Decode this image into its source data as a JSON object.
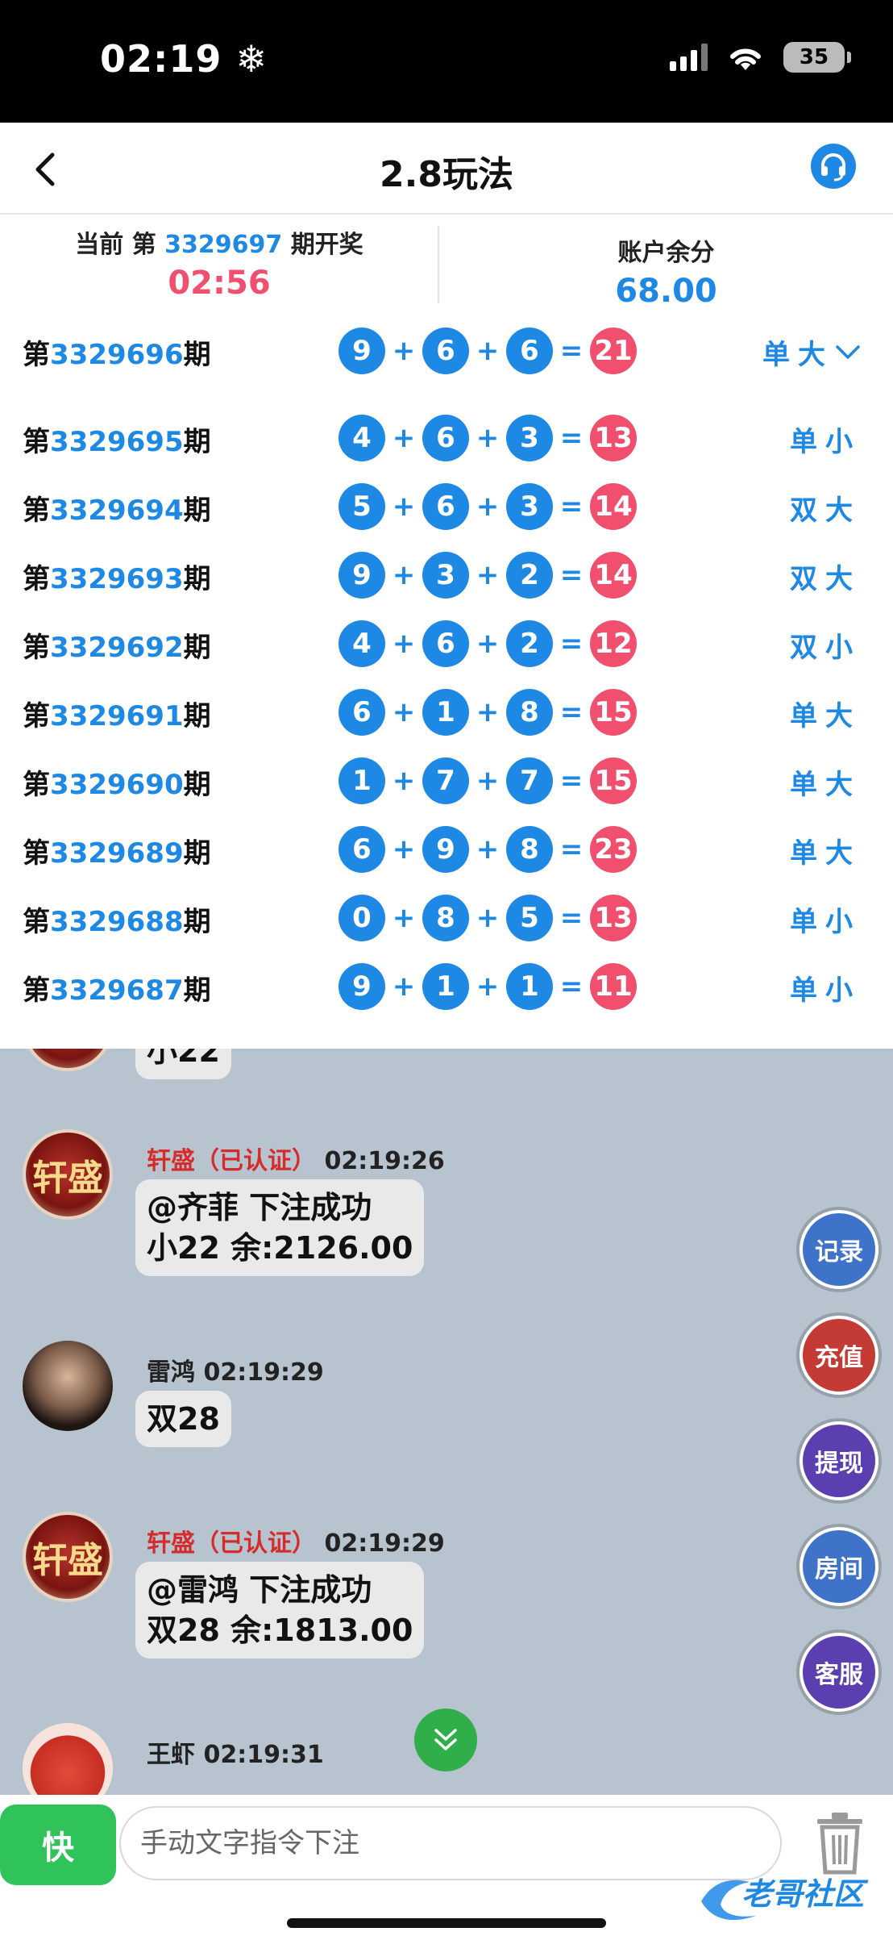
{
  "status": {
    "time": "02:19",
    "battery": "35"
  },
  "header": {
    "title": "2.8玩法"
  },
  "current": {
    "prefix": "当前 第",
    "period": "3329697",
    "suffix": "期开奖",
    "countdown": "02:56"
  },
  "account": {
    "label": "账户余分",
    "balance": "68.00"
  },
  "history": [
    {
      "pre": "第",
      "period": "3329696",
      "post": "期",
      "n1": "9",
      "n2": "6",
      "n3": "6",
      "sum": "21",
      "result": "单大"
    },
    {
      "pre": "第",
      "period": "3329695",
      "post": "期",
      "n1": "4",
      "n2": "6",
      "n3": "3",
      "sum": "13",
      "result": "单小"
    },
    {
      "pre": "第",
      "period": "3329694",
      "post": "期",
      "n1": "5",
      "n2": "6",
      "n3": "3",
      "sum": "14",
      "result": "双大"
    },
    {
      "pre": "第",
      "period": "3329693",
      "post": "期",
      "n1": "9",
      "n2": "3",
      "n3": "2",
      "sum": "14",
      "result": "双大"
    },
    {
      "pre": "第",
      "period": "3329692",
      "post": "期",
      "n1": "4",
      "n2": "6",
      "n3": "2",
      "sum": "12",
      "result": "双小"
    },
    {
      "pre": "第",
      "period": "3329691",
      "post": "期",
      "n1": "6",
      "n2": "1",
      "n3": "8",
      "sum": "15",
      "result": "单大"
    },
    {
      "pre": "第",
      "period": "3329690",
      "post": "期",
      "n1": "1",
      "n2": "7",
      "n3": "7",
      "sum": "15",
      "result": "单大"
    },
    {
      "pre": "第",
      "period": "3329689",
      "post": "期",
      "n1": "6",
      "n2": "9",
      "n3": "8",
      "sum": "23",
      "result": "单大"
    },
    {
      "pre": "第",
      "period": "3329688",
      "post": "期",
      "n1": "0",
      "n2": "8",
      "n3": "5",
      "sum": "13",
      "result": "单小"
    },
    {
      "pre": "第",
      "period": "3329687",
      "post": "期",
      "n1": "9",
      "n2": "1",
      "n3": "1",
      "sum": "11",
      "result": "单小"
    }
  ],
  "ops": {
    "plus": "+",
    "eq": "="
  },
  "chat": {
    "partial_bubble": "小22",
    "messages": [
      {
        "name": "轩盛",
        "tag": "（已认证）",
        "time": "02:19:26",
        "line1": "@齐菲  下注成功",
        "line2": "小22 余:2126.00",
        "avatar_text": "轩盛"
      },
      {
        "name": "雷鸿",
        "time": "02:19:29",
        "line1": "双28"
      },
      {
        "name": "轩盛",
        "tag": "（已认证）",
        "time": "02:19:29",
        "line1": "@雷鸿  下注成功",
        "line2": "双28 余:1813.00",
        "avatar_text": "轩盛"
      },
      {
        "name": "王虾",
        "time": "02:19:31"
      }
    ]
  },
  "side_buttons": [
    {
      "label": "记录",
      "color": "#3f73c9"
    },
    {
      "label": "充值",
      "color": "#c43a35"
    },
    {
      "label": "提现",
      "color": "#5b3fb0"
    },
    {
      "label": "房间",
      "color": "#3f73c9"
    },
    {
      "label": "客服",
      "color": "#5b3fb0"
    }
  ],
  "input": {
    "quick_label": "快",
    "placeholder": "手动文字指令下注"
  },
  "watermark": "老哥社区"
}
